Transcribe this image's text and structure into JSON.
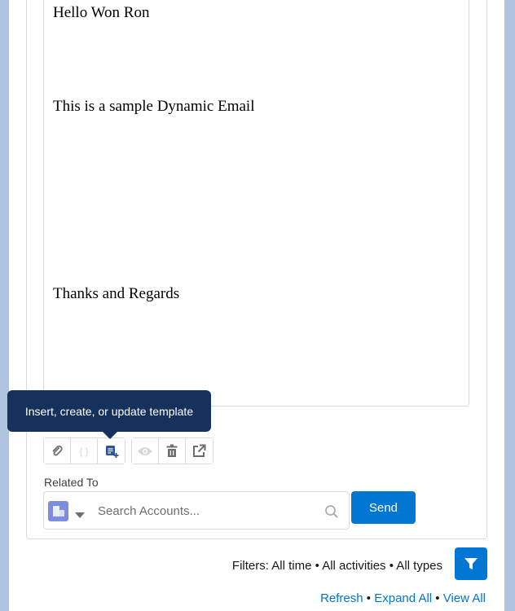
{
  "editor": {
    "lines": [
      "Hello Won Ron",
      "This is a sample Dynamic Email",
      "Thanks and Regards"
    ]
  },
  "toolbar": {
    "tooltip": "Insert, create, or update template"
  },
  "related": {
    "label": "Related To",
    "placeholder": "Search Accounts...",
    "send_label": "Send"
  },
  "filters": {
    "text": "Filters: All time • All activities • All types"
  },
  "links": {
    "refresh": "Refresh",
    "expand": "Expand All",
    "view_all": "View All",
    "sep": "•"
  },
  "colors": {
    "brand": "#0176d3",
    "tooltip": "#16325c",
    "object_icon": "#7f8de1"
  }
}
